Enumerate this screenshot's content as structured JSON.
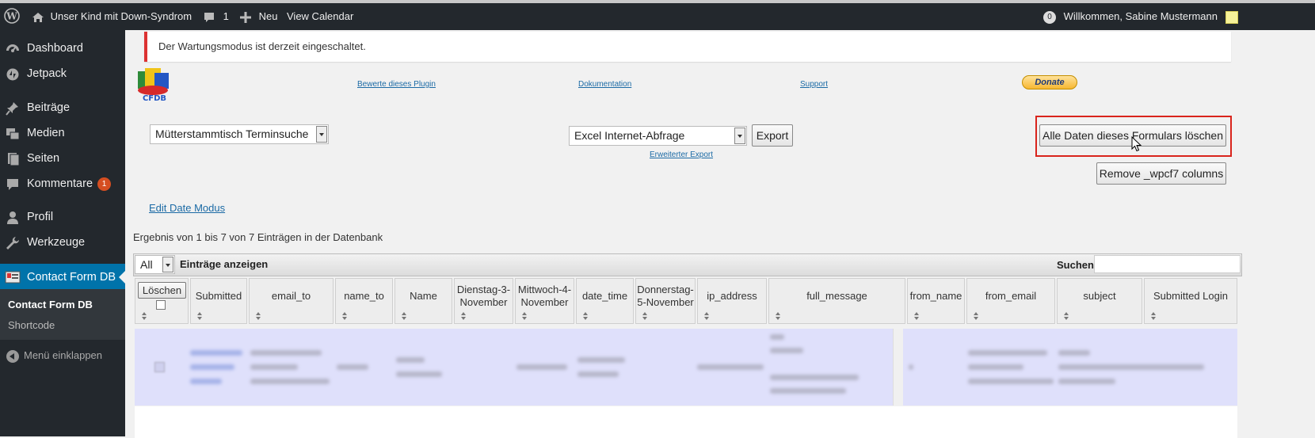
{
  "adminbar": {
    "site_name": "Unser Kind mit Down-Syndrom",
    "comments_count": "1",
    "new_label": "Neu",
    "calendar_label": "View Calendar",
    "notification_count": "0",
    "greeting": "Willkommen, Sabine Mustermann"
  },
  "sidebar": {
    "items": [
      {
        "label": "Dashboard",
        "icon": "dashboard-icon"
      },
      {
        "label": "Jetpack",
        "icon": "jetpack-icon"
      },
      {
        "label": "Beiträge",
        "icon": "pin-icon"
      },
      {
        "label": "Medien",
        "icon": "media-icon"
      },
      {
        "label": "Seiten",
        "icon": "pages-icon"
      },
      {
        "label": "Kommentare",
        "icon": "comment-icon",
        "badge": "1"
      },
      {
        "label": "Profil",
        "icon": "user-icon"
      },
      {
        "label": "Werkzeuge",
        "icon": "wrench-icon"
      },
      {
        "label": "Contact Form DB",
        "icon": "contact-form-db-icon"
      }
    ],
    "submenu": [
      "Contact Form DB",
      "Shortcode"
    ],
    "collapse_label": "Menü einklappen"
  },
  "notice": "Der Wartungsmodus ist derzeit eingeschaltet.",
  "plugin_header": {
    "logo_text": "CFDB",
    "rate_link": "Bewerte dieses Plugin",
    "docs_link": "Dokumentation",
    "support_link": "Support",
    "donate_label": "Donate"
  },
  "controls": {
    "form_select": "Mütterstammtisch Terminsuche",
    "export_select": "Excel Internet-Abfrage",
    "export_button": "Export",
    "advanced_export_link": "Erweiterter Export",
    "delete_all_button": "Alle Daten dieses Formulars löschen",
    "remove_columns_button": "Remove _wpcf7 columns",
    "edit_date_link": "Edit Date Modus"
  },
  "result_text": "Ergebnis von 1 bis 7 von 7 Einträgen in der Datenbank",
  "table": {
    "length_value": "All",
    "length_label": "Einträge anzeigen",
    "search_label": "Suchen",
    "delete_button": "Löschen",
    "columns": [
      "Submitted",
      "email_to",
      "name_to",
      "Name",
      "Dienstag-3-November",
      "Mittwoch-4-November",
      "date_time",
      "Donnerstag-5-November",
      "ip_address",
      "full_message",
      "from_name",
      "from_email",
      "subject",
      "Submitted Login"
    ]
  }
}
